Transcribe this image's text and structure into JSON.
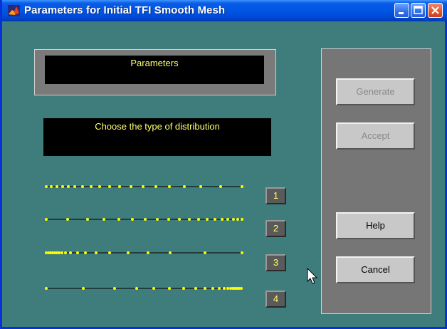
{
  "window": {
    "title": "Parameters for Initial TFI Smooth Mesh",
    "controls": [
      "minimize-icon",
      "maximize-icon",
      "close-icon"
    ]
  },
  "params_panel": {
    "label": "Parameters"
  },
  "distribution_panel": {
    "label": "Choose the type of distribution"
  },
  "distribution_options": [
    {
      "label": "1",
      "pattern": "uniform"
    },
    {
      "label": "2",
      "pattern": "clustered-right"
    },
    {
      "label": "3",
      "pattern": "clustered-left"
    },
    {
      "label": "4",
      "pattern": "clustered-right-strong"
    }
  ],
  "actions": {
    "generate": {
      "label": "Generate",
      "enabled": false
    },
    "accept": {
      "label": "Accept",
      "enabled": false
    },
    "help": {
      "label": "Help",
      "enabled": true
    },
    "cancel": {
      "label": "Cancel",
      "enabled": true
    }
  },
  "colors": {
    "background": "#3f7d7d",
    "text_highlight": "#ffff6e",
    "dot": "#ffff00"
  }
}
